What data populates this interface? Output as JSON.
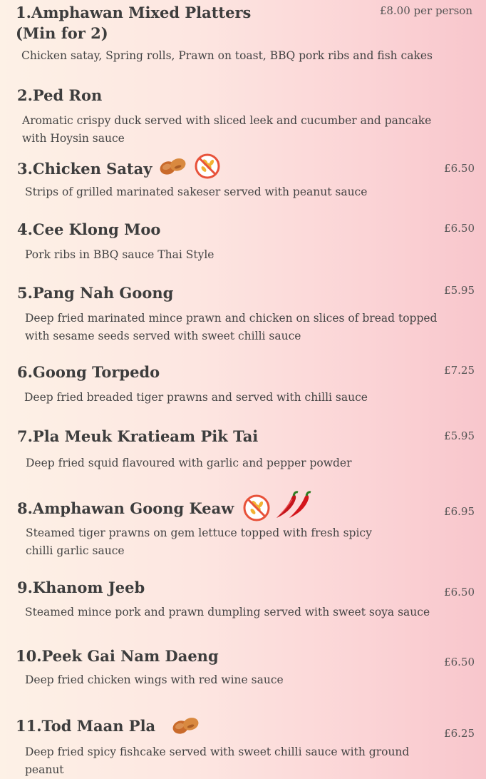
{
  "items": [
    {
      "name": "1.Amphawan Mixed Platters",
      "subname": "(Min for 2)",
      "price": "£8.00 per person",
      "desc": "Chicken satay, Spring rolls, Prawn on toast, BBQ pork ribs and fish cakes"
    },
    {
      "name": "2.Ped Ron",
      "price": "",
      "desc": "Aromatic crispy duck served with sliced leek and cucumber and pancake with Hoysin sauce"
    },
    {
      "name": "3.Chicken Satay",
      "price": "£6.50",
      "desc": "Strips of grilled marinated sakeser served with peanut sauce",
      "icons": [
        "peanut-icon",
        "gluten-free-icon"
      ]
    },
    {
      "name": "4.Cee Klong Moo",
      "price": "£6.50",
      "desc": "Pork ribs in BBQ sauce Thai Style"
    },
    {
      "name": "5.Pang Nah Goong",
      "price": "£5.95",
      "desc": "Deep fried marinated mince prawn and chicken on slices of bread topped with sesame seeds served with sweet chilli sauce"
    },
    {
      "name": "6.Goong Torpedo",
      "price": "£7.25",
      "desc": "Deep fried breaded tiger prawns and served with chilli sauce"
    },
    {
      "name": "7.Pla Meuk Kratieam Pik Tai",
      "price": "£5.95",
      "desc": "Deep fried squid flavoured with garlic and pepper powder"
    },
    {
      "name": "8.Amphawan Goong Keaw",
      "price": "£6.95",
      "desc": "Steamed tiger prawns on gem lettuce topped with fresh spicy chilli garlic sauce",
      "icons": [
        "gluten-free-icon",
        "chilli-icon"
      ]
    },
    {
      "name": "9.Khanom Jeeb",
      "price": "£6.50",
      "desc": "Steamed mince pork and prawn dumpling served with sweet soya sauce"
    },
    {
      "name": "10.Peek Gai Nam Daeng",
      "price": "£6.50",
      "desc": "Deep fried chicken wings with red wine sauce"
    },
    {
      "name": "11.Tod Maan Pla",
      "price": "£6.25",
      "desc": "Deep fried spicy fishcake served with sweet chilli sauce with ground peanut",
      "icons": [
        "peanut-icon"
      ]
    }
  ],
  "colors": {
    "chilli": "#c4161c",
    "peanut": "#c96a2b",
    "gluten_free_ring": "#e8523a",
    "wheat": "#f2b233"
  }
}
